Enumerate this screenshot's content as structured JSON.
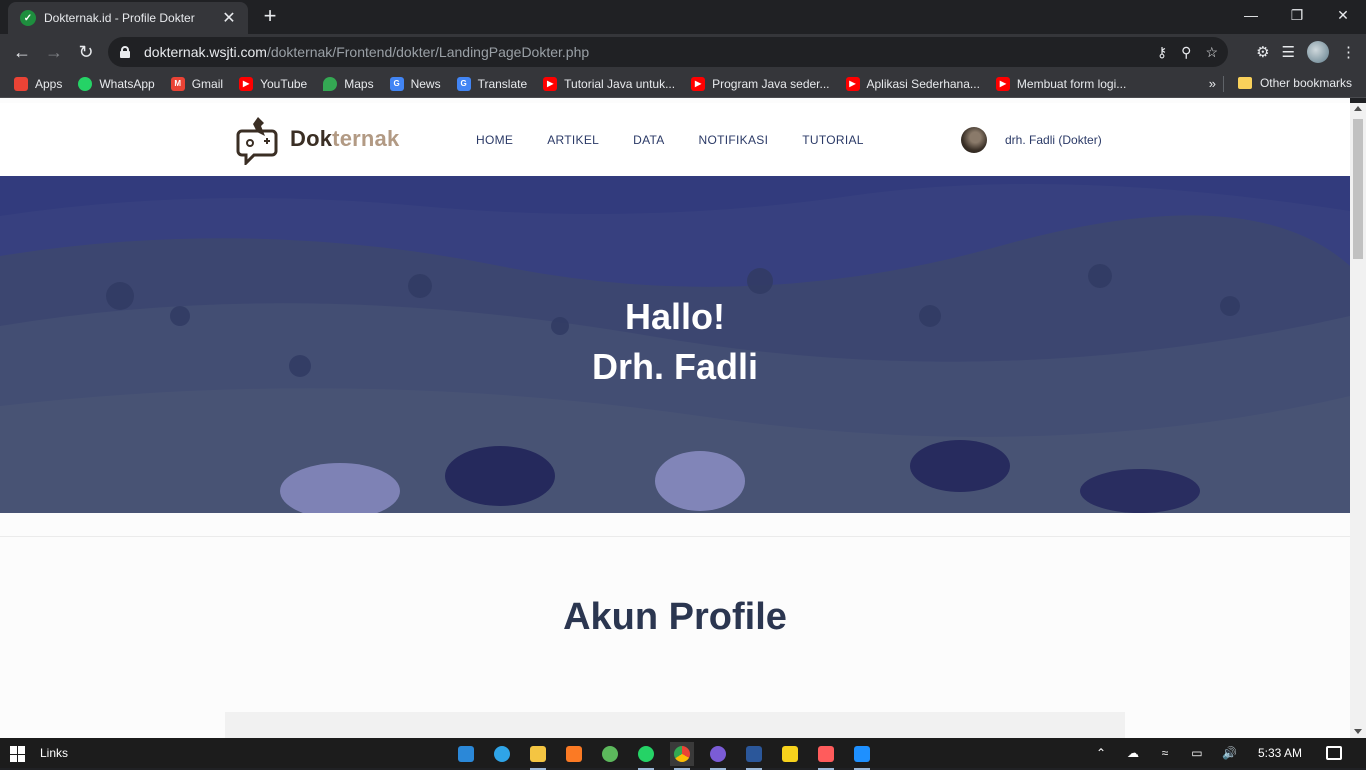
{
  "browser": {
    "tab_title": "Dokternak.id - Profile Dokter",
    "tab_close": "✕",
    "new_tab": "+",
    "url_host": "dokternak.wsjti.com",
    "url_path": "/dokternak/Frontend/dokter/LandingPageDokter.php",
    "bookmarks": [
      {
        "label": "Apps",
        "icon": "apps-grid-icon",
        "color": "#ea4335"
      },
      {
        "label": "WhatsApp",
        "icon": "whatsapp-icon",
        "color": "#25d366"
      },
      {
        "label": "Gmail",
        "icon": "gmail-icon",
        "color": "#ea4335"
      },
      {
        "label": "YouTube",
        "icon": "youtube-icon",
        "color": "#ff0000"
      },
      {
        "label": "Maps",
        "icon": "maps-icon",
        "color": "#34a853"
      },
      {
        "label": "News",
        "icon": "news-icon",
        "color": "#4285f4"
      },
      {
        "label": "Translate",
        "icon": "translate-icon",
        "color": "#4285f4"
      },
      {
        "label": "Tutorial Java untuk...",
        "icon": "youtube-icon",
        "color": "#ff0000"
      },
      {
        "label": "Program Java seder...",
        "icon": "youtube-icon",
        "color": "#ff0000"
      },
      {
        "label": "Aplikasi Sederhana...",
        "icon": "youtube-icon",
        "color": "#ff0000"
      },
      {
        "label": "Membuat form logi...",
        "icon": "youtube-icon",
        "color": "#ff0000"
      }
    ],
    "bookmarks_more": "»",
    "other_bookmarks": "Other bookmarks"
  },
  "site": {
    "logo_dark": "Dok",
    "logo_light": "ternak",
    "nav": [
      "HOME",
      "ARTIKEL",
      "DATA",
      "NOTIFIKASI",
      "TUTORIAL"
    ],
    "user_name": "drh. Fadli (Dokter)",
    "hero_line1": "Hallo!",
    "hero_line2": "Drh. Fadli",
    "section_title": "Akun Profile"
  },
  "taskbar": {
    "links_label": "Links",
    "time": "5:33 AM",
    "apps": [
      {
        "name": "tile-icon",
        "color": "#2b88d8"
      },
      {
        "name": "edge-icon",
        "color": "#2fa4e7"
      },
      {
        "name": "file-explorer-icon",
        "color": "#f4c542"
      },
      {
        "name": "xampp-icon",
        "color": "#fb7a24"
      },
      {
        "name": "terminal-icon",
        "color": "#5cb85c"
      },
      {
        "name": "whatsapp-icon",
        "color": "#25d366"
      },
      {
        "name": "chrome-icon",
        "color": "#fbbc05"
      },
      {
        "name": "app-icon",
        "color": "#7b5cd6"
      },
      {
        "name": "word-icon",
        "color": "#2b579a"
      },
      {
        "name": "sticky-notes-icon",
        "color": "#f7d21c"
      },
      {
        "name": "sublime-icon",
        "color": "#ff5c5c"
      },
      {
        "name": "media-player-icon",
        "color": "#1e90ff"
      }
    ]
  }
}
